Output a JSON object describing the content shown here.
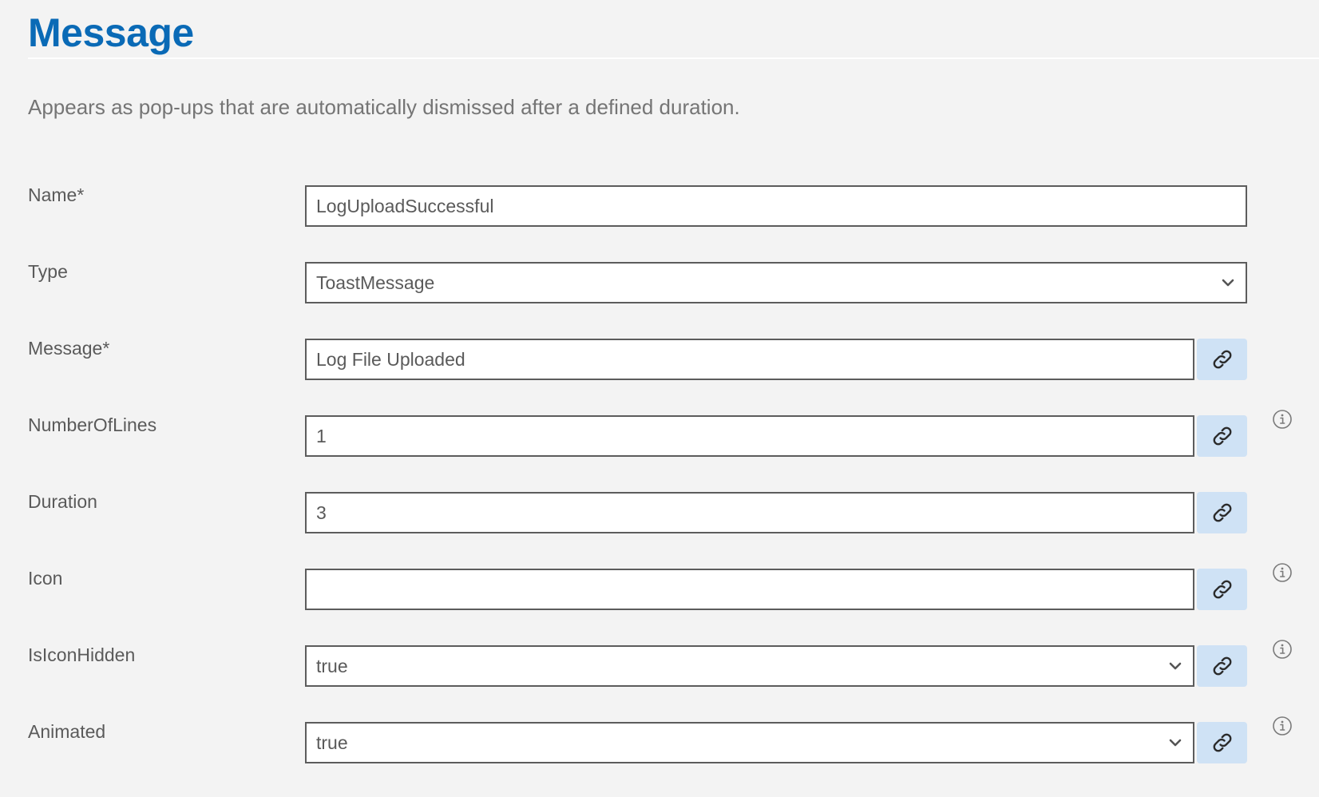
{
  "header": {
    "title": "Message",
    "description": "Appears as pop-ups that are automatically dismissed after a defined duration."
  },
  "fields": {
    "name": {
      "label": "Name*",
      "value": "LogUploadSuccessful"
    },
    "type": {
      "label": "Type",
      "value": "ToastMessage"
    },
    "message": {
      "label": "Message*",
      "value": "Log File Uploaded"
    },
    "number_of_lines": {
      "label": "NumberOfLines",
      "value": "1"
    },
    "duration": {
      "label": "Duration",
      "value": "3"
    },
    "icon": {
      "label": "Icon",
      "value": ""
    },
    "is_icon_hidden": {
      "label": "IsIconHidden",
      "value": "true"
    },
    "animated": {
      "label": "Animated",
      "value": "true"
    }
  },
  "icons": {
    "link": "link-icon",
    "info": "info-icon",
    "dropdown": "chevron-down-icon"
  },
  "colors": {
    "title": "#0a6ab6",
    "link_button_bg": "#cfe2f5",
    "page_bg": "#f3f3f3",
    "field_border": "#5c5c5c"
  }
}
